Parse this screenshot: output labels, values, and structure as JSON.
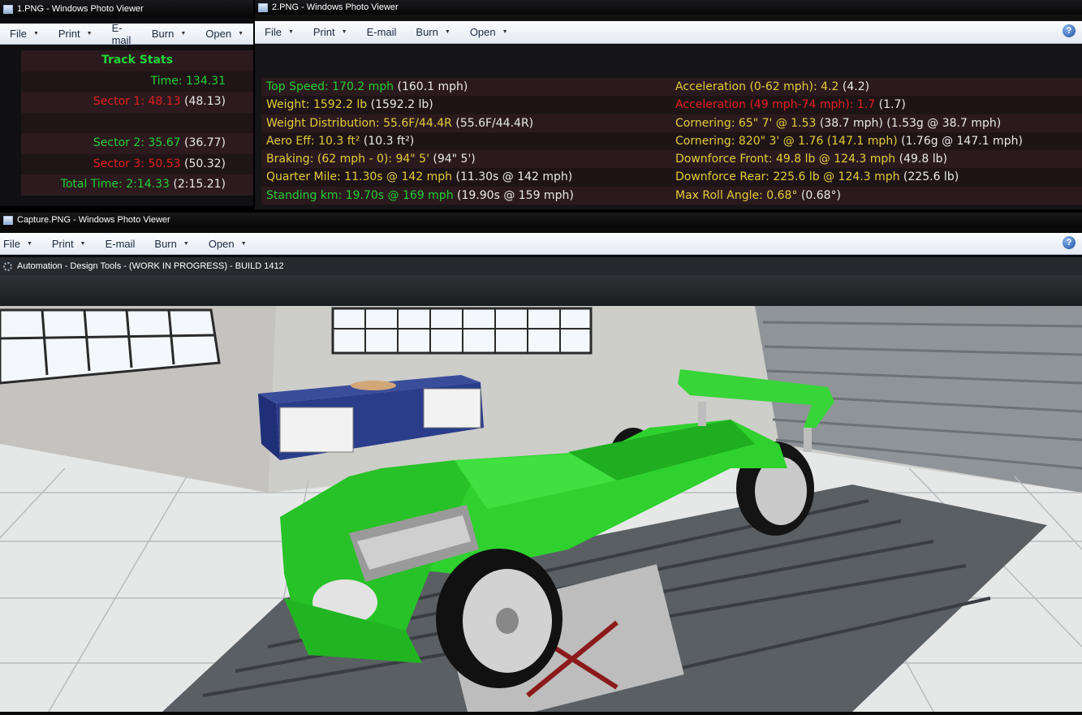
{
  "window1": {
    "title": "1.PNG - Windows Photo Viewer",
    "menu": [
      "File",
      "Print",
      "E-mail",
      "Burn",
      "Open"
    ],
    "track_stats": {
      "title": "Track Stats",
      "rows": [
        {
          "label": "Time: 134.31",
          "compare": "",
          "color": "green"
        },
        {
          "label": "Sector 1: 48.13",
          "compare": " (48.13)",
          "color": "red"
        },
        {
          "label": "",
          "compare": "",
          "color": "green"
        },
        {
          "label": "Sector 2: 35.67",
          "compare": " (36.77)",
          "color": "green"
        },
        {
          "label": "Sector 3: 50.53",
          "compare": " (50.32)",
          "color": "red"
        },
        {
          "label": "Total Time: 2:14.33",
          "compare": " (2:15.21)",
          "color": "green"
        }
      ]
    }
  },
  "window2": {
    "title": "2.PNG - Windows Photo Viewer",
    "menu": [
      "File",
      "Print",
      "E-mail",
      "Burn",
      "Open"
    ],
    "stats": [
      {
        "left": {
          "label": "Top Speed: 170.2 mph",
          "compare": " (160.1 mph)",
          "color": "green"
        },
        "right": {
          "label": "Acceleration (0-62 mph): 4.2",
          "compare": " (4.2)",
          "color": "yellow"
        }
      },
      {
        "left": {
          "label": "Weight: 1592.2 lb",
          "compare": " (1592.2 lb)",
          "color": "yellow"
        },
        "right": {
          "label": "Acceleration (49 mph-74 mph): 1.7",
          "compare": " (1.7)",
          "color": "red"
        }
      },
      {
        "left": {
          "label": "Weight Distribution: 55.6F/44.4R",
          "compare": " (55.6F/44.4R)",
          "color": "yellow"
        },
        "right": {
          "label": "Cornering: 65\" 7' @ 1.53",
          "compare": " (38.7 mph) (1.53g @ 38.7 mph)",
          "color": "yellow"
        }
      },
      {
        "left": {
          "label": "Aero Eff: 10.3 ft²",
          "compare": " (10.3 ft²)",
          "color": "yellow"
        },
        "right": {
          "label": "Cornering: 820\" 3' @ 1.76 (147.1 mph)",
          "compare": " (1.76g @ 147.1 mph)",
          "color": "yellow"
        }
      },
      {
        "left": {
          "label": "Braking: (62 mph - 0): 94\" 5'",
          "compare": " (94\" 5')",
          "color": "yellow"
        },
        "right": {
          "label": "Downforce Front: 49.8 lb @ 124.3 mph",
          "compare": " (49.8 lb)",
          "color": "yellow"
        }
      },
      {
        "left": {
          "label": "Quarter Mile: 11.30s @ 142 mph",
          "compare": " (11.30s @ 142 mph)",
          "color": "yellow"
        },
        "right": {
          "label": "Downforce Rear: 225.6 lb @ 124.3 mph",
          "compare": " (225.6 lb)",
          "color": "yellow"
        }
      },
      {
        "left": {
          "label": "Standing km: 19.70s @ 169 mph",
          "compare": " (19.90s @ 159 mph)",
          "color": "green"
        },
        "right": {
          "label": "Max Roll Angle: 0.68°",
          "compare": " (0.68°)",
          "color": "yellow"
        }
      }
    ]
  },
  "window3": {
    "title": "Capture.PNG - Windows Photo Viewer",
    "menu": [
      "File",
      "Print",
      "E-mail",
      "Burn",
      "Open"
    ],
    "app_title": "Automation - Design Tools - (WORK IN PROGRESS) - BUILD 1412"
  },
  "colors": {
    "green": "#22cf36",
    "yellow": "#e3cc3a",
    "red": "#e02020",
    "car_green": "#2fd12f"
  }
}
